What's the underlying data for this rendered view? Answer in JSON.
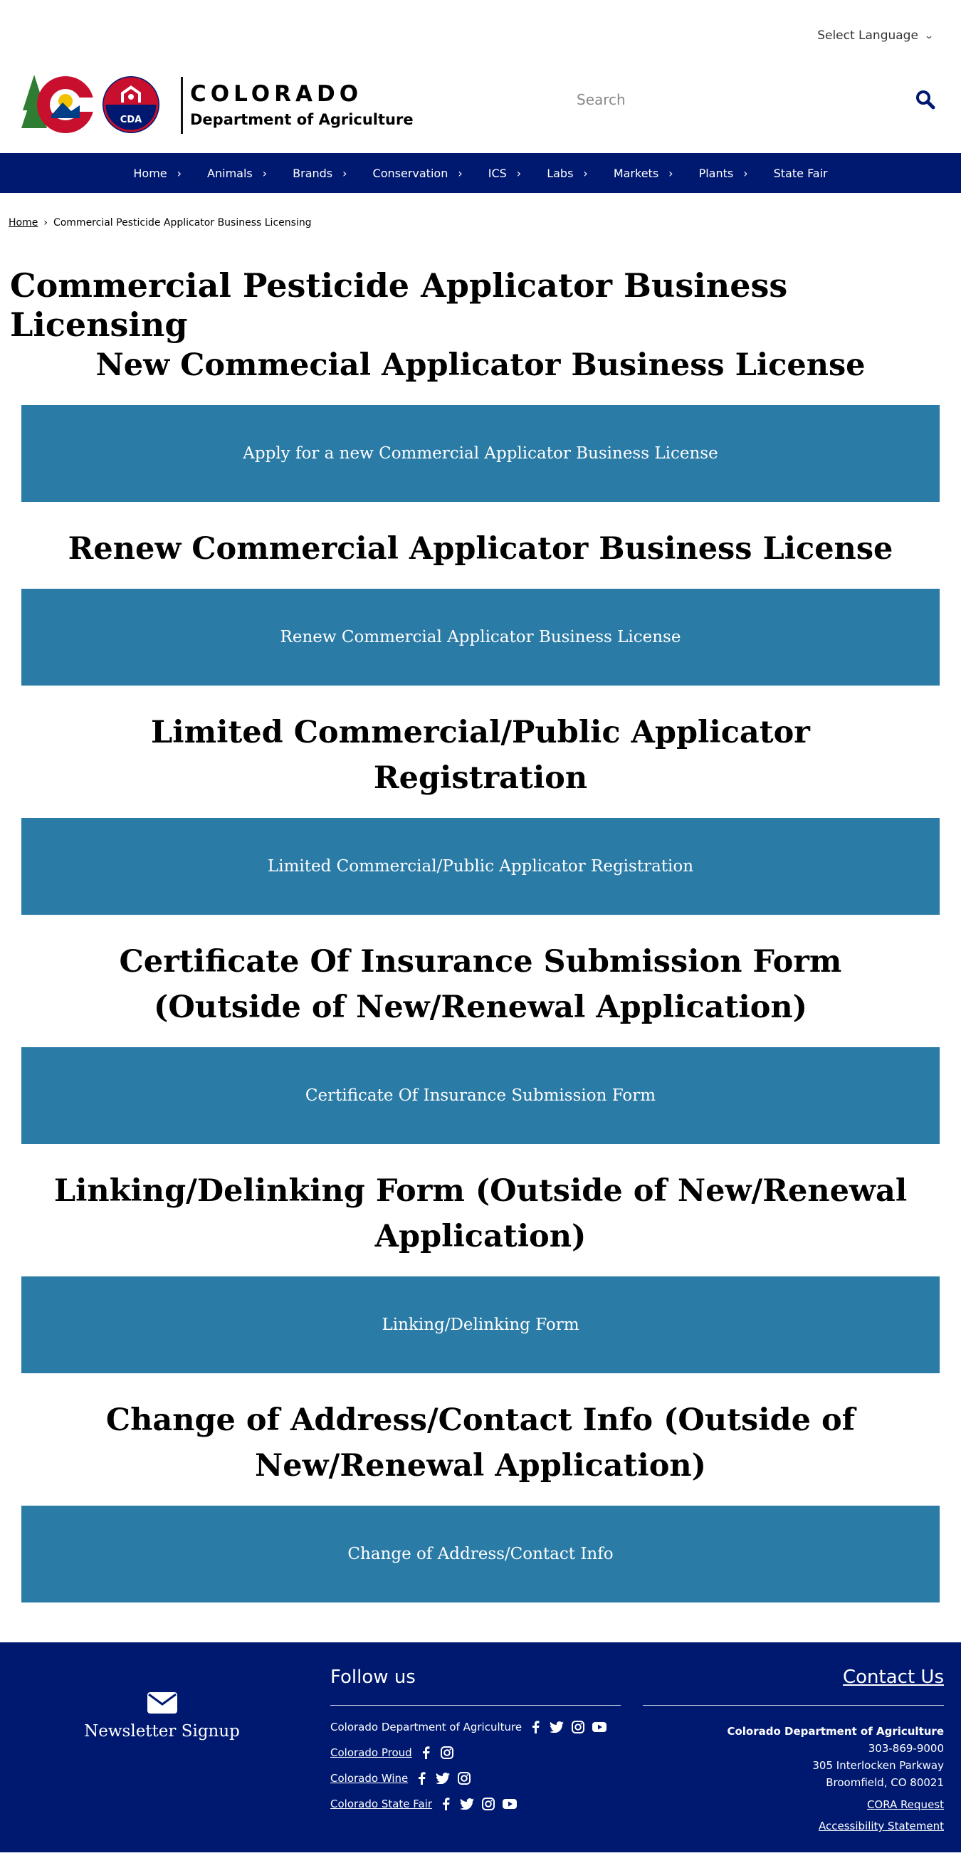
{
  "top": {
    "language_label": "Select Language"
  },
  "header": {
    "logo_title": "COLORADO",
    "logo_subtitle": "Department of Agriculture",
    "logo_badge": "CDA",
    "search_placeholder": "Search"
  },
  "nav": {
    "items": [
      {
        "label": "Home"
      },
      {
        "label": "Animals"
      },
      {
        "label": "Brands"
      },
      {
        "label": "Conservation"
      },
      {
        "label": "ICS"
      },
      {
        "label": "Labs"
      },
      {
        "label": "Markets"
      },
      {
        "label": "Plants"
      },
      {
        "label": "State Fair"
      }
    ]
  },
  "breadcrumb": {
    "home": "Home",
    "current": "Commercial Pesticide Applicator Business Licensing"
  },
  "page": {
    "title": "Commercial Pesticide Applicator Business Licensing",
    "sections": [
      {
        "heading": "New Commecial Applicator Business License",
        "button": "Apply for a new Commercial Applicator Business License"
      },
      {
        "heading": "Renew Commercial Applicator Business License",
        "button": "Renew Commercial Applicator Business License"
      },
      {
        "heading": "Limited Commercial/Public Applicator Registration",
        "button": "Limited Commercial/Public Applicator Registration"
      },
      {
        "heading": "Certificate Of Insurance Submission Form (Outside of New/Renewal Application)",
        "button": "Certificate Of Insurance Submission Form"
      },
      {
        "heading": "Linking/Delinking Form (Outside of New/Renewal Application)",
        "button": "Linking/Delinking Form"
      },
      {
        "heading": "Change of Address/Contact Info (Outside of New/Renewal Application)",
        "button": "Change of Address/Contact Info"
      }
    ]
  },
  "footer": {
    "newsletter_label": "Newsletter Signup",
    "follow_title": "Follow us",
    "follow_rows": [
      {
        "label": "Colorado Department of Agriculture"
      },
      {
        "label": "Colorado Proud"
      },
      {
        "label": "Colorado Wine"
      },
      {
        "label": "Colorado State Fair"
      }
    ],
    "contact_title": "Contact Us",
    "contact_org": "Colorado Department of Agriculture",
    "contact_phone": "303-869-9000",
    "contact_street": "305 Interlocken Parkway",
    "contact_city": "Broomfield, CO 80021",
    "cora_label": "CORA Request",
    "accessibility_label": "Accessibility Statement"
  },
  "colors": {
    "nav_bg": "#001970",
    "button_bg": "#2b7ba7"
  }
}
